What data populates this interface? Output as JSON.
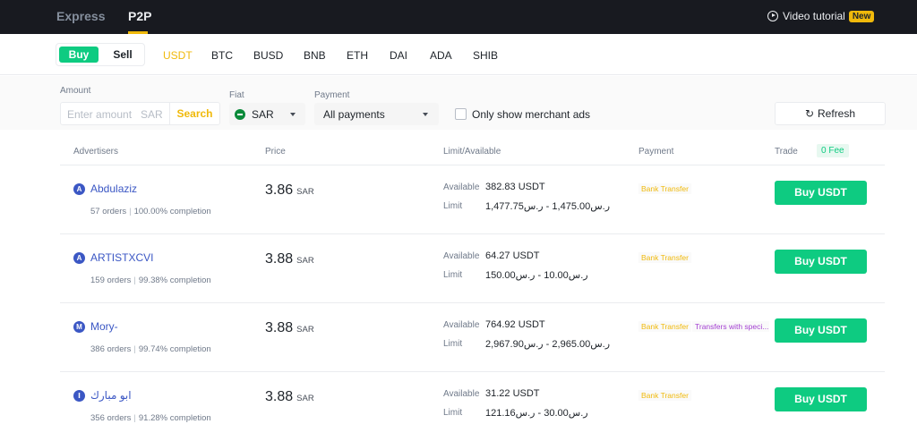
{
  "topbar": {
    "tabs": [
      "Express",
      "P2P"
    ],
    "video_label": "Video tutorial",
    "new_badge": "New"
  },
  "trade_toggle": {
    "buy": "Buy",
    "sell": "Sell"
  },
  "assets": [
    "USDT",
    "BTC",
    "BUSD",
    "BNB",
    "ETH",
    "DAI",
    "ADA",
    "SHIB"
  ],
  "filters": {
    "amount_label": "Amount",
    "amount_placeholder": "Enter amount",
    "amount_currency": "SAR",
    "search_label": "Search",
    "fiat_label": "Fiat",
    "fiat_value": "SAR",
    "payment_label": "Payment",
    "payment_value": "All payments",
    "merchant_only_label": "Only show merchant ads",
    "refresh_label": "Refresh"
  },
  "table": {
    "headers": {
      "advertisers": "Advertisers",
      "price": "Price",
      "limit": "Limit/Available",
      "payment": "Payment",
      "trade": "Trade",
      "fee": "0 Fee"
    },
    "available_key": "Available",
    "limit_key": "Limit",
    "rows": [
      {
        "avatar": "A",
        "name": "Abdulaziz",
        "orders": "57 orders",
        "completion": "100.00% completion",
        "price": "3.86",
        "price_unit": "SAR",
        "available": "382.83 USDT",
        "limit": "ر.س1,475.00 - ر.س1,477.75",
        "payments": [
          "Bank Transfer"
        ],
        "button": "Buy USDT"
      },
      {
        "avatar": "A",
        "name": "ARTISTXCVI",
        "orders": "159 orders",
        "completion": "99.38% completion",
        "price": "3.88",
        "price_unit": "SAR",
        "available": "64.27 USDT",
        "limit": "ر.س10.00 - ر.س150.00",
        "payments": [
          "Bank Transfer"
        ],
        "button": "Buy USDT"
      },
      {
        "avatar": "M",
        "name": "Mory-",
        "orders": "386 orders",
        "completion": "99.74% completion",
        "price": "3.88",
        "price_unit": "SAR",
        "available": "764.92 USDT",
        "limit": "ر.س2,965.00 - ر.س2,967.90",
        "payments": [
          "Bank Transfer",
          "Transfers with speci..."
        ],
        "button": "Buy USDT"
      },
      {
        "avatar": "ا",
        "name": "ابو مبارك",
        "orders": "356 orders",
        "completion": "91.28% completion",
        "price": "3.88",
        "price_unit": "SAR",
        "available": "31.22 USDT",
        "limit": "ر.س30.00 - ر.س121.16",
        "payments": [
          "Bank Transfer"
        ],
        "button": "Buy USDT"
      }
    ]
  },
  "colors": {
    "accent": "#f0b90b",
    "buy_green": "#0ecb81",
    "advertiser_blue": "#3b57c4",
    "dark_bar": "#181a20"
  }
}
